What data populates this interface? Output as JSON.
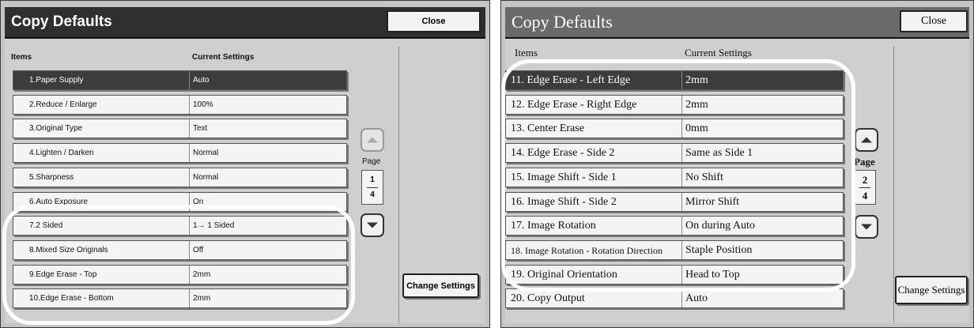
{
  "left": {
    "title": "Copy Defaults",
    "close_label": "Close",
    "col_items": "Items",
    "col_settings": "Current Settings",
    "rows": [
      {
        "label": "1.Paper Supply",
        "value": "Auto",
        "selected": true
      },
      {
        "label": "2.Reduce / Enlarge",
        "value": "100%"
      },
      {
        "label": "3.Original Type",
        "value": "Text"
      },
      {
        "label": "4.Lighten / Darken",
        "value": "Normal"
      },
      {
        "label": "5.Sharpness",
        "value": "Normal"
      },
      {
        "label": "6.Auto Exposure",
        "value": "On"
      },
      {
        "label": "7.2 Sided",
        "value": "1→ 1 Sided"
      },
      {
        "label": "8.Mixed Size Originals",
        "value": "Off"
      },
      {
        "label": "9.Edge Erase - Top",
        "value": "2mm"
      },
      {
        "label": "10.Edge Erase - Bottom",
        "value": "2mm"
      }
    ],
    "page_label": "Page",
    "page_current": "1",
    "page_total": "4",
    "change_settings_label": "Change Settings"
  },
  "right": {
    "title": "Copy Defaults",
    "close_label": "Close",
    "col_items": "Items",
    "col_settings": "Current Settings",
    "rows": [
      {
        "label": "11. Edge Erase - Left Edge",
        "value": "2mm",
        "selected": true
      },
      {
        "label": "12. Edge Erase - Right Edge",
        "value": "2mm"
      },
      {
        "label": "13. Center Erase",
        "value": "0mm"
      },
      {
        "label": "14. Edge Erase - Side 2",
        "value": "Same as Side 1"
      },
      {
        "label": "15. Image Shift - Side 1",
        "value": "No Shift"
      },
      {
        "label": "16. Image Shift - Side 2",
        "value": "Mirror Shift"
      },
      {
        "label": "17. Image Rotation",
        "value": "On during Auto"
      },
      {
        "label": "18. Image Rotation - Rotation Direction",
        "value": "Staple Position"
      },
      {
        "label": "19. Original Orientation",
        "value": "Head to Top"
      },
      {
        "label": "20. Copy Output",
        "value": "Auto"
      }
    ],
    "page_label": "Page",
    "page_current": "2",
    "page_total": "4",
    "change_settings_label": "Change Settings"
  },
  "colors": {
    "panel_bg": "#c4c4c4",
    "title_bar_left": "#2f2f2f",
    "title_bar_right": "#6a6a6a",
    "selected_row": "#3c3c3c",
    "highlight_outline": "#ffffff"
  },
  "icons": {
    "scroll_up": "triangle-up-icon",
    "scroll_down": "triangle-down-icon"
  }
}
